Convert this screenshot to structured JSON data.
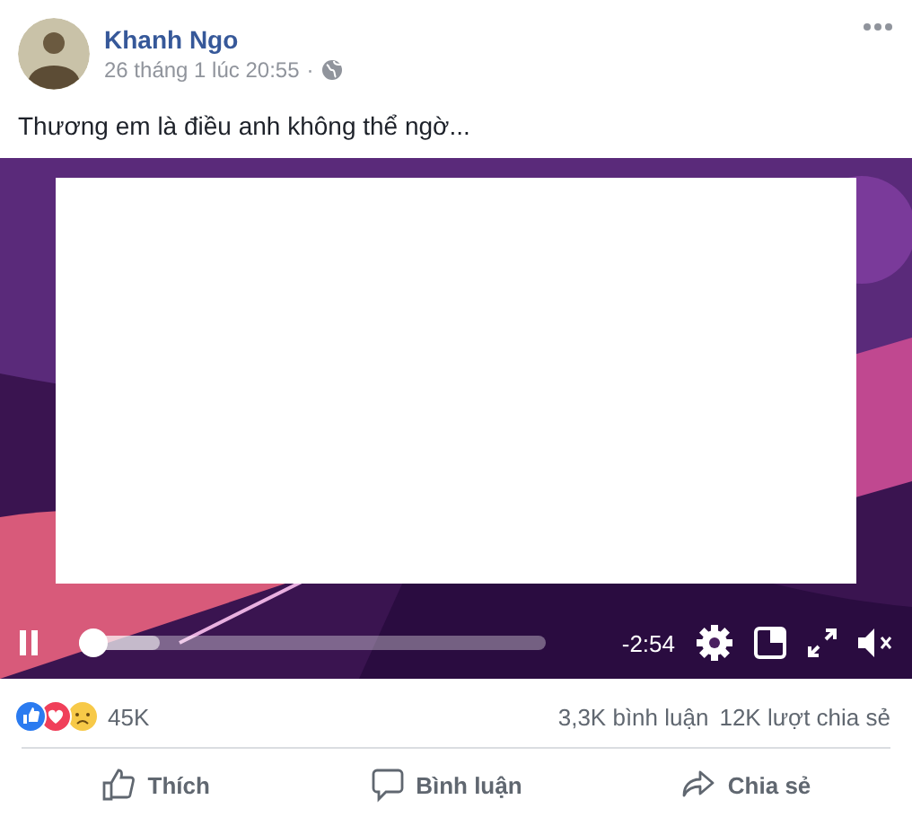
{
  "post": {
    "author": "Khanh Ngo",
    "time": "26 tháng 1 lúc 20:55",
    "separator": "·",
    "text": "Thương em là điều anh không thể ngờ..."
  },
  "video": {
    "kind": "picture",
    "playing": true,
    "muted": true,
    "level": 0.03,
    "remaining": "-2:54"
  },
  "stats": {
    "reactions": "45K",
    "comments": "3,3K bình luận",
    "shares": "12K lượt chia sẻ"
  },
  "actions": [
    {
      "kind": "like",
      "label": "Thích"
    },
    {
      "kind": "comment",
      "label": "Bình luận"
    },
    {
      "kind": "share",
      "label": "Chia sẻ"
    }
  ]
}
